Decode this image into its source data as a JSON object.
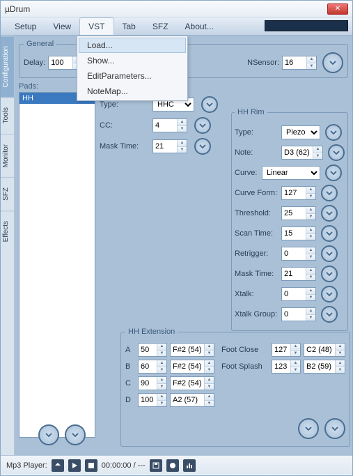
{
  "window": {
    "title": "µDrum"
  },
  "menu": {
    "items": [
      "Setup",
      "View",
      "VST",
      "Tab",
      "SFZ",
      "About..."
    ],
    "active_index": 2,
    "dropdown": [
      "Load...",
      "Show...",
      "EditParameters...",
      "NoteMap..."
    ],
    "dropdown_hover": 0
  },
  "side_tabs": [
    "Configuration",
    "Tools",
    "Monitor",
    "SFZ",
    "Effects"
  ],
  "side_active": 0,
  "general": {
    "legend": "General",
    "delay_label": "Delay:",
    "delay_value": "100",
    "nsensor_label": "NSensor:",
    "nsensor_value": "16"
  },
  "pads": {
    "label": "Pads:",
    "list": [
      "HH"
    ]
  },
  "hh_left": {
    "type_label": "Type:",
    "type_value": "HHC",
    "cc_label": "CC:",
    "cc_value": "4",
    "mask_label": "Mask Time:",
    "mask_value": "21"
  },
  "hh_rim": {
    "legend": "HH Rim",
    "type_label": "Type:",
    "type_value": "Piezo",
    "note_label": "Note:",
    "note_value": "D3 (62)",
    "curve_label": "Curve:",
    "curve_value": "Linear",
    "curveform_label": "Curve Form:",
    "curveform_value": "127",
    "threshold_label": "Threshold:",
    "threshold_value": "25",
    "scantime_label": "Scan Time:",
    "scantime_value": "15",
    "retrigger_label": "Retrigger:",
    "retrigger_value": "0",
    "mask_label": "Mask Time:",
    "mask_value": "21",
    "xtalk_label": "Xtalk:",
    "xtalk_value": "0",
    "xtalkg_label": "Xtalk Group:",
    "xtalkg_value": "0"
  },
  "hh_ext": {
    "legend": "HH Extension",
    "rows": [
      {
        "l": "A",
        "v": "50",
        "n": "F#2 (54)"
      },
      {
        "l": "B",
        "v": "60",
        "n": "F#2 (54)"
      },
      {
        "l": "C",
        "v": "90",
        "n": "F#2 (54)"
      },
      {
        "l": "D",
        "v": "100",
        "n": "A2 (57)"
      }
    ],
    "foot_close_label": "Foot Close",
    "foot_close_v": "127",
    "foot_close_n": "C2 (48)",
    "foot_splash_label": "Foot Splash",
    "foot_splash_v": "123",
    "foot_splash_n": "B2 (59)"
  },
  "status": {
    "label": "Mp3 Player:",
    "time": "00:00:00 / ---"
  }
}
